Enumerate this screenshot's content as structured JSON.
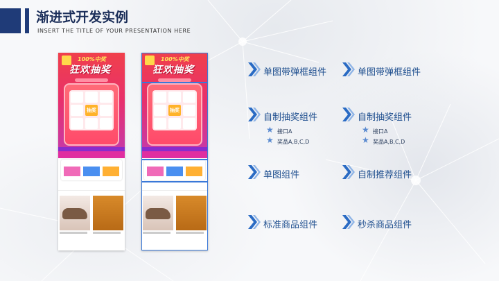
{
  "header": {
    "title": "渐进式开发实例",
    "subtitle": "INSERT THE TITLE OF YOUR PRESENTATION HERE"
  },
  "phones": [
    {
      "tag_line": "100%中奖",
      "headline": "狂欢抽奖",
      "center_cell": "抽奖"
    },
    {
      "tag_line": "100%中奖",
      "headline": "狂欢抽奖",
      "center_cell": "抽奖"
    }
  ],
  "left_column": {
    "items": [
      {
        "label": "单图带弹框组件"
      },
      {
        "label": "自制抽奖组件",
        "subs": [
          "接口A",
          "奖品A,B,C,D"
        ]
      },
      {
        "label": "单图组件"
      },
      {
        "label": "标准商品组件"
      }
    ]
  },
  "right_column": {
    "items": [
      {
        "label": "单图带弹框组件"
      },
      {
        "label": "自制抽奖组件",
        "subs": [
          "接口A",
          "奖品A,B,C,D"
        ]
      },
      {
        "label": "自制推荐组件"
      },
      {
        "label": "秒杀商品组件"
      }
    ]
  },
  "colors": {
    "accent": "#1f3b78",
    "label": "#1f4f8f",
    "chevron": "#2a6bc4",
    "highlight_box": "#3a78d8"
  }
}
